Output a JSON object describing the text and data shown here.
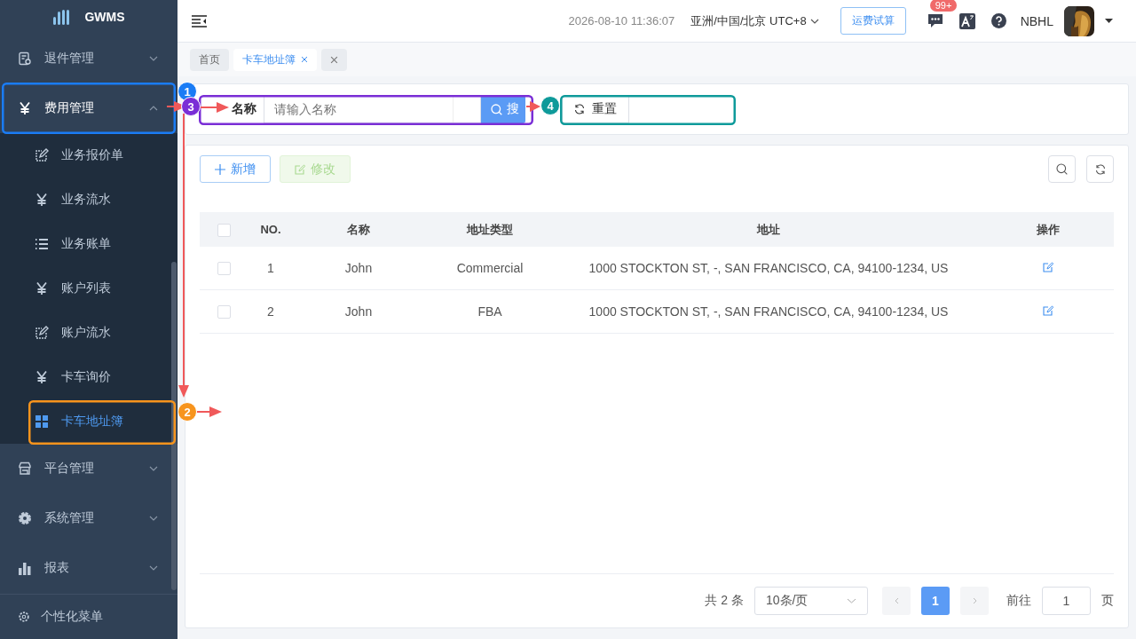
{
  "sidebar": {
    "logo": "GWMS",
    "menu": [
      {
        "label": "退件管理",
        "kind": "receipt",
        "expanded": false
      },
      {
        "label": "费用管理",
        "kind": "yen",
        "expanded": true,
        "children": [
          {
            "label": "业务报价单",
            "kind": "edit",
            "selected": false
          },
          {
            "label": "业务流水",
            "kind": "yen",
            "selected": false
          },
          {
            "label": "业务账单",
            "kind": "list",
            "selected": false
          },
          {
            "label": "账户列表",
            "kind": "yen",
            "selected": false
          },
          {
            "label": "账户流水",
            "kind": "edit",
            "selected": false
          },
          {
            "label": "卡车询价",
            "kind": "yen",
            "selected": false
          },
          {
            "label": "卡车地址簿",
            "kind": "grid",
            "selected": true
          }
        ]
      },
      {
        "label": "平台管理",
        "kind": "store",
        "expanded": false
      },
      {
        "label": "系统管理",
        "kind": "gear",
        "expanded": false
      },
      {
        "label": "报表",
        "kind": "chart",
        "expanded": false
      }
    ],
    "footer": "个性化菜单"
  },
  "header": {
    "datetime": "2026-08-10 11:36:07",
    "timezone": "亚洲/中国/北京 UTC+8",
    "freight_button": "运费试算",
    "message_badge": "99+",
    "username": "NBHL"
  },
  "tags": [
    {
      "label": "首页",
      "selected": false,
      "closable": false
    },
    {
      "label": "卡车地址簿",
      "selected": true,
      "closable": true
    }
  ],
  "search": {
    "label": "名称",
    "placeholder": "请输入名称",
    "search_button": "搜",
    "reset_button": "重置"
  },
  "toolbar": [
    {
      "label": "新增",
      "kind": "primary",
      "disabled": false
    },
    {
      "label": "修改",
      "kind": "success",
      "disabled": true
    }
  ],
  "table": {
    "all_checked": false,
    "columns": [
      "NO.",
      "名称",
      "地址类型",
      "地址",
      "操作"
    ],
    "rows": [
      {
        "checked": false,
        "no": "1",
        "name": "John",
        "type": "Commercial",
        "address": "1000 STOCKTON ST, -, SAN FRANCISCO, CA, 94100-1234, US"
      },
      {
        "checked": false,
        "no": "2",
        "name": "John",
        "type": "FBA",
        "address": "1000 STOCKTON ST, -, SAN FRANCISCO, CA, 94100-1234, US"
      }
    ]
  },
  "pagination": {
    "total": "共 2 条",
    "page_size": "10条/页",
    "pages": [
      {
        "label": "1",
        "selected": true
      }
    ],
    "goto_label": "前往",
    "goto_value": "1",
    "page_unit": "页"
  },
  "annotations": [
    {
      "number": "1",
      "color": "#1a7cf5"
    },
    {
      "number": "3",
      "color": "#7a2ed6"
    },
    {
      "number": "4",
      "color": "#0e9a9a"
    },
    {
      "number": "2",
      "color": "#f7941d"
    }
  ]
}
